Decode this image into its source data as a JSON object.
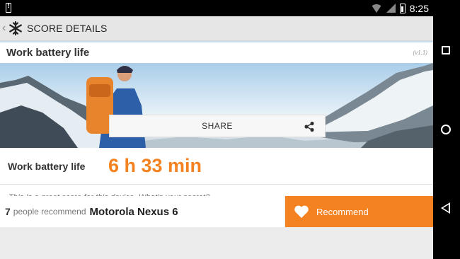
{
  "status_bar": {
    "time": "8:25",
    "icons": [
      "alert-icon",
      "wifi-icon",
      "signal-icon",
      "battery-icon"
    ]
  },
  "nav_bar": {
    "buttons": [
      "recents-button",
      "home-button",
      "back-button"
    ]
  },
  "action_bar": {
    "title": "SCORE DETAILS",
    "app_icon": "snowflake-icon"
  },
  "score": {
    "section_title": "Work battery life",
    "version": "(v1.1)",
    "share_label": "SHARE",
    "result_label": "Work battery life",
    "result_value": "6 h 33 min",
    "message": "This is a great score for this device. What's your secret?"
  },
  "recommend": {
    "count": "7",
    "text": "people recommend",
    "device": "Motorola Nexus 6",
    "button_label": "Recommend"
  },
  "colors": {
    "accent": "#f58220",
    "background": "#ececec"
  }
}
